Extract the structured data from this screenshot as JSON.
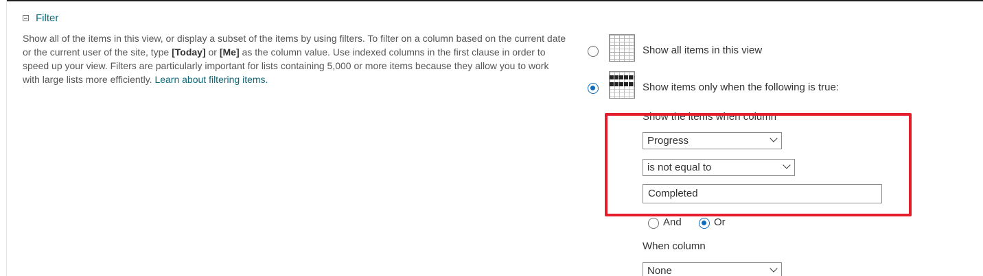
{
  "filter": {
    "title": "Filter",
    "description": {
      "part1": "Show all of the items in this view, or display a subset of the items by using filters. To filter on a column based on the current date or the current user of the site, type ",
      "today": "[Today]",
      "or": " or ",
      "me": "[Me]",
      "part2": " as the column value. Use indexed columns in the first clause in order to speed up your view. Filters are particularly important for lists containing 5,000 or more items because they allow you to work with large lists more efficiently. ",
      "link": "Learn about filtering items."
    },
    "options": {
      "show_all": "Show all items in this view",
      "show_filtered": "Show items only when the following is true:"
    },
    "condition1": {
      "label": "Show the items when column",
      "column": "Progress",
      "operator": "is not equal to",
      "value": "Completed"
    },
    "logic": {
      "and": "And",
      "or": "Or"
    },
    "condition2": {
      "label": "When column",
      "column": "None"
    },
    "highlight_color": "#e61e2b",
    "accent_color": "#0f6cbd",
    "link_color": "#0b6a78"
  }
}
